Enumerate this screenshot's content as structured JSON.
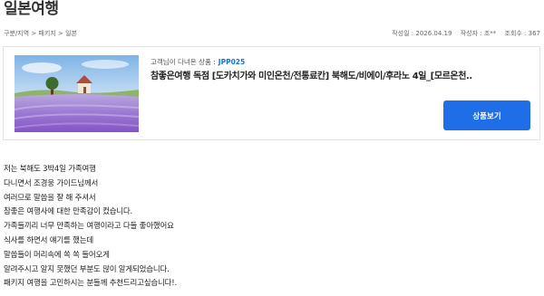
{
  "page": {
    "title": "일본여행"
  },
  "breadcrumb": "구분/지역 > 패키지 > 일본",
  "post_info": {
    "date": "작성일 : 2026.04.19",
    "author": "작성자 : 조**",
    "views": "조회수 : 367"
  },
  "product": {
    "label": "고객님이 다녀온 상품 :",
    "code": "JPP025",
    "name": "참좋은여행 독점 [도카치가와 미인온천/전통료칸] 북해도/비에이/후라노 4일_[모르온천..",
    "button_label": "상품보기",
    "thumbnail": "lavender-field-landscape-image"
  },
  "review_lines": [
    "저는 북해도 3박4일 가족여행",
    "다니면서 조경웅 가이드님께서",
    "여러므로 말씀을 잘 해 주셔서",
    "참좋은 여행사에 대한 만족감이 컸습니다.",
    "가족들끼리 너무 만족하는 여행이라고 다들 좋아했어요",
    "식사를 하면서 얘기를 했는데",
    "말씀들이 머리속에 쏙 쏙 들어오게",
    "알려주시고 알지 못했던 부분도 많이 알게되었습니다.",
    "패키지 여행을 고민하시는 분들께 추천드리고싶습니다!."
  ],
  "colors": {
    "accent": "#1f6ee8",
    "code": "#1a6fd6",
    "border": "#e3e3e3"
  }
}
